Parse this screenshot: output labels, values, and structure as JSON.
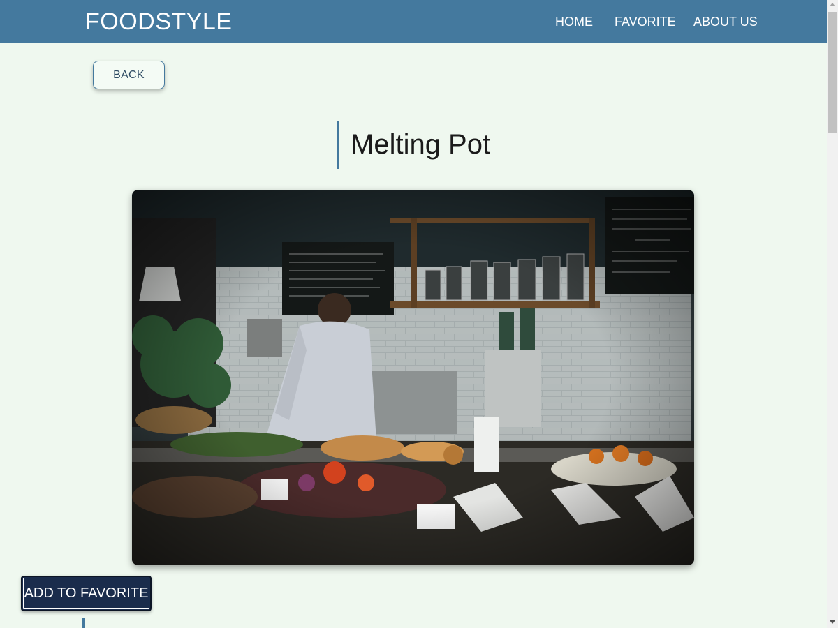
{
  "navbar": {
    "brand": "FOODSTYLE",
    "links": [
      "HOME",
      "FAVORITE",
      "ABOUT US"
    ],
    "background": "#44799e"
  },
  "page": {
    "back_label": "BACK",
    "title": "Melting Pot",
    "favorite_label": "ADD TO FAVORITE",
    "background": "#eff8ef"
  },
  "hero_image": {
    "subject": "cafe counter with food display and barista"
  }
}
